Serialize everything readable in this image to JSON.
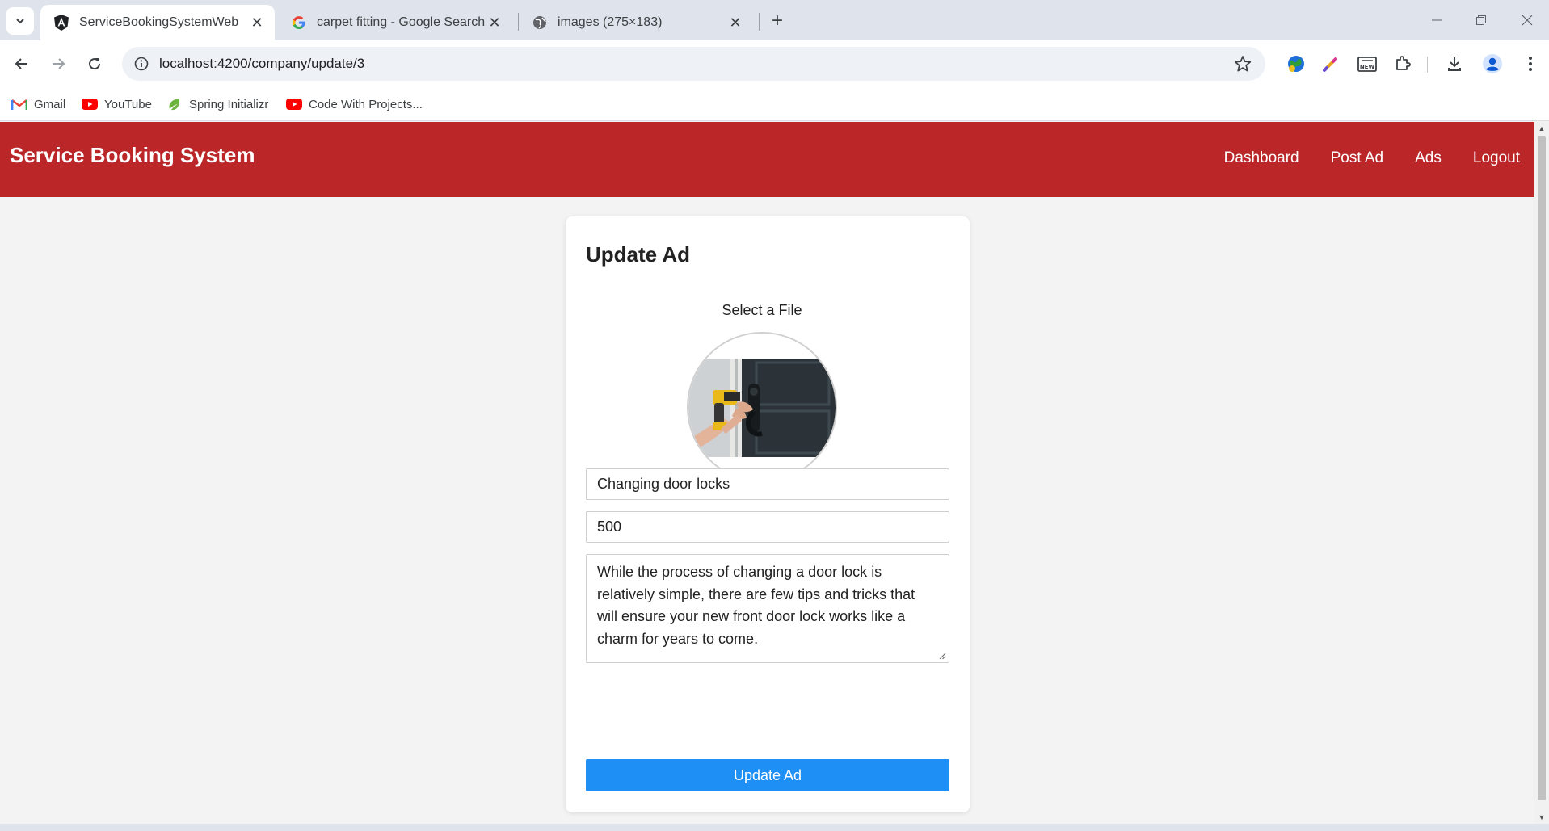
{
  "browser": {
    "tabs": [
      {
        "title": "ServiceBookingSystemWeb",
        "favicon": "angular-icon",
        "active": true
      },
      {
        "title": "carpet fitting - Google Search",
        "favicon": "google-icon",
        "active": false
      },
      {
        "title": "images (275×183)",
        "favicon": "globe-icon",
        "active": false
      }
    ],
    "url": "localhost:4200/company/update/3",
    "bookmarks": [
      {
        "label": "Gmail",
        "icon": "gmail-icon"
      },
      {
        "label": "YouTube",
        "icon": "youtube-icon"
      },
      {
        "label": "Spring Initializr",
        "icon": "spring-icon"
      },
      {
        "label": "Code With Projects...",
        "icon": "youtube-icon"
      }
    ]
  },
  "app": {
    "brand": "Service Booking System",
    "nav": [
      "Dashboard",
      "Post Ad",
      "Ads",
      "Logout"
    ],
    "accent_color": "#bb2629"
  },
  "form": {
    "title": "Update Ad",
    "file_label": "Select a File",
    "image_icon": "door-lock-photo",
    "service_name": "Changing door locks",
    "price": "500",
    "description": "While the process of changing a door lock is relatively simple, there are few tips and tricks that will ensure your new front door lock works like a charm for years to come.",
    "submit_label": "Update Ad",
    "submit_color": "#1e90f5"
  }
}
